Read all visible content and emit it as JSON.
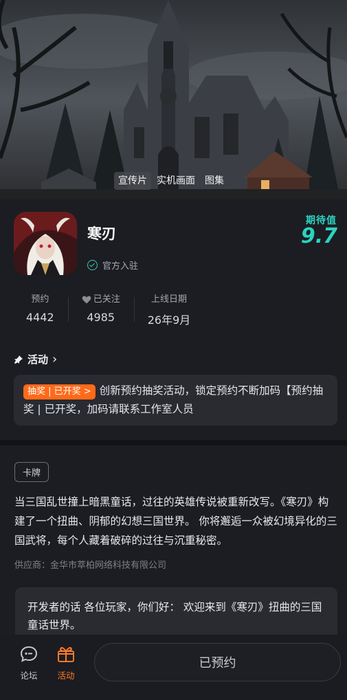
{
  "media_tabs": [
    "宣传片",
    "实机画面",
    "图集"
  ],
  "app": {
    "name": "寒刃",
    "official": "官方入驻",
    "score_label": "期待值",
    "score": "9.7"
  },
  "stats": [
    {
      "label": "预约",
      "value": "4442"
    },
    {
      "label": "已关注",
      "value": "4985"
    },
    {
      "label": "上线日期",
      "value": "26年9月"
    }
  ],
  "activity": {
    "title": "活动",
    "badge": "抽奖 | 已开奖 >",
    "text": "创新预约抽奖活动，锁定预约不断加码【预约抽奖 | 已开奖，加码请联系工作室人员"
  },
  "description": {
    "tag": "卡牌",
    "text": "当三国乱世撞上暗黑童话，过往的英雄传说被重新改写。《寒刃》构建了一个扭曲、阴郁的幻想三国世界。 你将邂逅一众被幻境异化的三国武将，每个人藏着破碎的过往与沉重秘密。",
    "supplier": "供应商：金华市萃柏网络科技有限公司",
    "dev_note": "开发者的话  各位玩家，你们好：  欢迎来到《寒刃》扭曲的三国童话世界。"
  },
  "bottom": {
    "forum": "论坛",
    "activity": "活动",
    "reserve": "已预约"
  },
  "colors": {
    "accent_teal": "#2ad4c0",
    "accent_orange": "#ff6a1a",
    "background": "#1c1d22"
  }
}
